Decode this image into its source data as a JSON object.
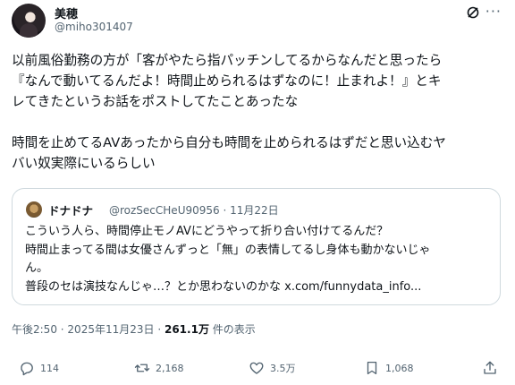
{
  "user": {
    "name": "美穂",
    "handle": "@miho301407"
  },
  "post": {
    "lines": [
      "以前風俗勤務の方が「客がやたら指パッチンしてるからなんだと思ったら",
      "『なんで動いてるんだよ！時間止められるはずなのに！止まれよ！』とキ",
      "レてきたというお話をポストしてたことあったな"
    ],
    "lines2": [
      "時間を止めてるAVあったから自分も時間を止められるはずだと思い込むヤ",
      "バい奴実際にいるらしい"
    ]
  },
  "quote": {
    "name": "ドナドナ",
    "handle": "@rozSecCHeU90956",
    "date": "11月22日",
    "lines": [
      "こういう人ら、時間停止モノAVにどうやって折り合い付けてるんだ？",
      "時間止まってる間は女優さんずっと「無」の表情してるし身体も動かないじゃ",
      "ん。",
      "普段のセは演技なんじゃ…？とか思わないのかな x.com/funnydata_info..."
    ]
  },
  "meta": {
    "time": "午後2:50",
    "date": "2025年11月23日",
    "views": "261.1万",
    "views_label": "件の表示"
  },
  "actions": {
    "replies": "114",
    "reposts": "2,168",
    "likes": "3.5万",
    "bookmarks": "1,068"
  }
}
